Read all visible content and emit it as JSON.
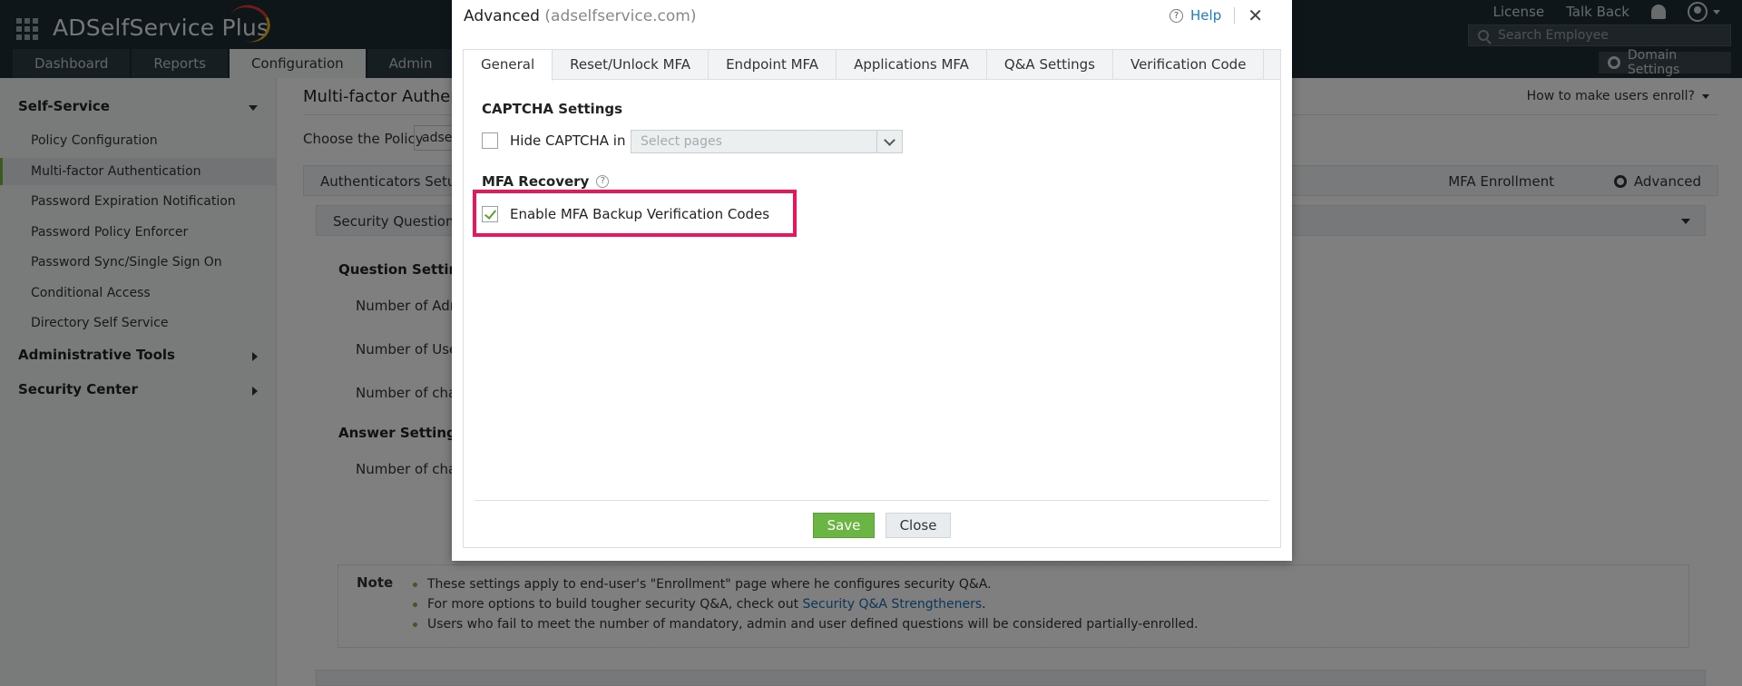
{
  "header": {
    "brand": "ADSelfService Plus",
    "links": [
      "License",
      "Talk Back"
    ],
    "search_placeholder": "Search Employee",
    "domain_settings": "Domain Settings",
    "nav_tabs": [
      "Dashboard",
      "Reports",
      "Configuration",
      "Admin"
    ],
    "active_tab": "Configuration"
  },
  "sidebar": {
    "self_service": "Self-Service",
    "items": [
      "Policy Configuration",
      "Multi-factor Authentication",
      "Password Expiration Notification",
      "Password Policy Enforcer",
      "Password Sync/Single Sign On",
      "Conditional Access",
      "Directory Self Service"
    ],
    "active_item": "Multi-factor Authentication",
    "admin_tools": "Administrative Tools",
    "security_center": "Security Center"
  },
  "main": {
    "title": "Multi-factor Authentic",
    "howto": "How to make users enroll?",
    "policy_label": "Choose the Policy",
    "policy_value": "adse",
    "subtab_left": "Authenticators Setup",
    "mfa_enrollment": "MFA Enrollment",
    "advanced": "Advanced",
    "accordion": "Security Question &",
    "question_settings": "Question Setting",
    "rows": [
      "Number of Adm",
      "Number of User",
      "Number of char"
    ],
    "answer_settings": "Answer Settings",
    "answer_row": "Number of char",
    "note_label": "Note",
    "note_1": "These settings apply to end-user's \"Enrollment\" page where he configures security Q&A.",
    "note_2_prefix": "For more options to build tougher security Q&A, check out ",
    "note_2_link": "Security Q&A Strengtheners",
    "note_2_suffix": ".",
    "note_3": "Users who fail to meet the number of mandatory, admin and user defined questions will be considered partially-enrolled."
  },
  "dialog": {
    "title": "Advanced",
    "subtitle": "(adselfservice.com)",
    "help": "Help",
    "tabs": [
      "General",
      "Reset/Unlock MFA",
      "Endpoint MFA",
      "Applications MFA",
      "Q&A Settings",
      "Verification Code"
    ],
    "active_tab": "General",
    "captcha_heading": "CAPTCHA Settings",
    "hide_captcha_label": "Hide CAPTCHA in",
    "hide_captcha_checked": false,
    "select_placeholder": "Select pages",
    "mfa_recovery_heading": "MFA Recovery",
    "backup_codes_label": "Enable MFA Backup Verification Codes",
    "backup_codes_checked": true,
    "save": "Save",
    "close": "Close"
  },
  "colors": {
    "topbar": "#1e2c33",
    "accent_green": "#6bb544",
    "highlight": "#e8175d",
    "link": "#1a7cc4"
  }
}
